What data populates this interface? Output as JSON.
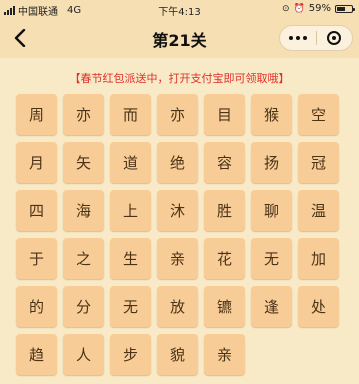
{
  "status_bar": {
    "carrier": "中国联通",
    "network": "4G",
    "time": "下午4:13",
    "battery_percent": "59%",
    "battery_level": 0.59
  },
  "nav": {
    "title": "第21关",
    "back_icon": "chevron-left-icon",
    "more_icon": "more-dots-icon",
    "close_icon": "target-circle-icon"
  },
  "notice": {
    "text": "【春节红包派送中，打开支付宝即可领取哦】",
    "color": "#e0312a"
  },
  "grid": {
    "cell_color": "#f8cc97",
    "characters": [
      "周",
      "亦",
      "而",
      "亦",
      "目",
      "猴",
      "空",
      "月",
      "矢",
      "道",
      "绝",
      "容",
      "扬",
      "冠",
      "四",
      "海",
      "上",
      "沐",
      "胜",
      "聊",
      "温",
      "于",
      "之",
      "生",
      "亲",
      "花",
      "无",
      "加",
      "的",
      "分",
      "无",
      "放",
      "镳",
      "逢",
      "处",
      "趋",
      "人",
      "步",
      "貌",
      "亲"
    ]
  }
}
